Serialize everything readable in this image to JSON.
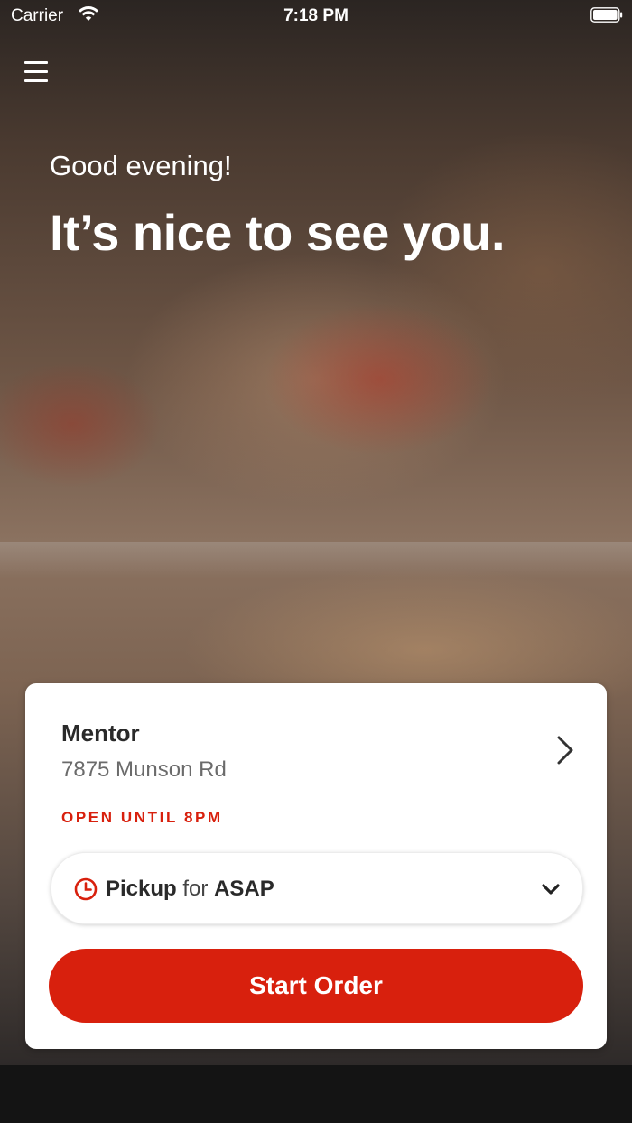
{
  "status_bar": {
    "carrier": "Carrier",
    "time": "7:18 PM"
  },
  "hero": {
    "greeting": "Good evening!",
    "headline": "It’s nice to see you."
  },
  "store": {
    "name": "Mentor",
    "address": "7875 Munson Rd",
    "hours": "OPEN UNTIL 8PM"
  },
  "order_mode": {
    "mode": "Pickup",
    "connector": "for",
    "time": "ASAP"
  },
  "actions": {
    "start_order": "Start Order"
  },
  "colors": {
    "accent": "#d8200d",
    "card": "#ffffff"
  },
  "icons": [
    "wifi-icon",
    "battery-icon",
    "hamburger-menu-icon",
    "chevron-right-icon",
    "clock-icon",
    "chevron-down-icon"
  ]
}
